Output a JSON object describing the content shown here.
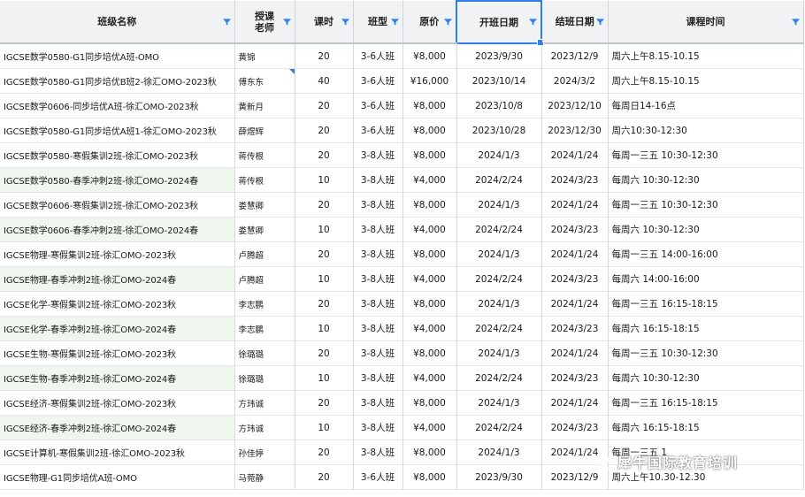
{
  "columns": [
    "班级名称",
    "授课老师",
    "课时",
    "班型",
    "原价",
    "开班日期",
    "结班日期",
    "课程时间"
  ],
  "rows": [
    {
      "name": "IGCSE数学0580-G1同步培优A班-OMO",
      "teacher": "黄锦",
      "hours": "20",
      "type": "3-6人班",
      "price": "¥8,000",
      "start": "2023/9/30",
      "end": "2023/12/9",
      "time": "周六上午8.15-10.15",
      "highlight": false
    },
    {
      "name": "IGCSE数学0580-G1同步培优B班2-徐汇OMO-2023秋",
      "teacher": "傅东东",
      "hours": "40",
      "type": "3-6人班",
      "price": "¥16,000",
      "start": "2023/10/14",
      "end": "2024/3/2",
      "time": "周六上午8.15-10.15",
      "highlight": false
    },
    {
      "name": "IGCSE数学0606-同步培优A班-徐汇OMO-2023秋",
      "teacher": "黄新月",
      "hours": "20",
      "type": "3-6人班",
      "price": "¥8,000",
      "start": "2023/10/8",
      "end": "2023/12/10",
      "time": "每周日14-16点",
      "highlight": false
    },
    {
      "name": "IGCSE数学0580-G1同步培优A班1-徐汇OMO-2023秋",
      "teacher": "薛煜辉",
      "hours": "20",
      "type": "3-6人班",
      "price": "¥8,000",
      "start": "2023/10/28",
      "end": "2023/12/30",
      "time": "周六10:30-12:30",
      "highlight": false
    },
    {
      "name": "IGCSE数学0580-寒假集训2班-徐汇OMO-2023秋",
      "teacher": "蒋传根",
      "hours": "20",
      "type": "3-8人班",
      "price": "¥8,000",
      "start": "2024/1/3",
      "end": "2024/1/24",
      "time": "每周一三五 10:30-12:30",
      "highlight": false
    },
    {
      "name": "IGCSE数学0580-春季冲刺2班-徐汇OMO-2024春",
      "teacher": "蒋传根",
      "hours": "10",
      "type": "3-8人班",
      "price": "¥4,000",
      "start": "2024/2/24",
      "end": "2024/3/23",
      "time": "每周六 10:30-12:30",
      "highlight": true
    },
    {
      "name": "IGCSE数学0606-寒假集训2班-徐汇OMO-2023秋",
      "teacher": "娄慧卿",
      "hours": "20",
      "type": "3-8人班",
      "price": "¥8,000",
      "start": "2024/1/3",
      "end": "2024/1/24",
      "time": "每周一三五 10:30-12:30",
      "highlight": false
    },
    {
      "name": "IGCSE数学0606-春季冲刺2班-徐汇OMO-2024春",
      "teacher": "娄慧卿",
      "hours": "10",
      "type": "3-8人班",
      "price": "¥4,000",
      "start": "2024/2/24",
      "end": "2024/3/23",
      "time": "每周六 10:30-12:30",
      "highlight": true
    },
    {
      "name": "IGCSE物理-寒假集训2班-徐汇OMO-2023秋",
      "teacher": "卢腾超",
      "hours": "20",
      "type": "3-8人班",
      "price": "¥8,000",
      "start": "2024/1/3",
      "end": "2024/1/24",
      "time": "每周一三五 14:00-16:00",
      "highlight": false
    },
    {
      "name": "IGCSE物理-春季冲刺2班-徐汇OMO-2024春",
      "teacher": "卢腾超",
      "hours": "10",
      "type": "3-8人班",
      "price": "¥4,000",
      "start": "2024/2/24",
      "end": "2024/3/23",
      "time": "每周六  14:00-16:00",
      "highlight": true
    },
    {
      "name": "IGCSE化学-寒假集训2班-徐汇OMO-2023秋",
      "teacher": "李志鹏",
      "hours": "20",
      "type": "3-8人班",
      "price": "¥8,000",
      "start": "2024/1/3",
      "end": "2024/1/24",
      "time": "每周一三五 16:15-18:15",
      "highlight": false
    },
    {
      "name": "IGCSE化学-春季冲刺2班-徐汇OMO-2024春",
      "teacher": "李志鹏",
      "hours": "10",
      "type": "3-8人班",
      "price": "¥4,000",
      "start": "2024/2/24",
      "end": "2024/3/23",
      "time": "每周六  16:15-18:15",
      "highlight": true
    },
    {
      "name": "IGCSE生物-寒假集训2班-徐汇OMO-2023秋",
      "teacher": "徐璐璐",
      "hours": "20",
      "type": "3-8人班",
      "price": "¥8,000",
      "start": "2024/1/3",
      "end": "2024/1/24",
      "time": "每周一三五 10:30-12:30",
      "highlight": false
    },
    {
      "name": "IGCSE生物-春季冲刺2班-徐汇OMO-2024春",
      "teacher": "徐璐璐",
      "hours": "10",
      "type": "3-8人班",
      "price": "¥4,000",
      "start": "2024/2/24",
      "end": "2024/3/23",
      "time": "每周六 10:30-12:30",
      "highlight": true
    },
    {
      "name": "IGCSE经济-寒假集训2班-徐汇OMO-2023秋",
      "teacher": "方玮诚",
      "hours": "20",
      "type": "3-8人班",
      "price": "¥8,000",
      "start": "2024/1/3",
      "end": "2024/1/24",
      "time": "每周一三五 16:15-18:15",
      "highlight": false
    },
    {
      "name": "IGCSE经济-春季冲刺2班-徐汇OMO-2024春",
      "teacher": "方玮诚",
      "hours": "10",
      "type": "3-8人班",
      "price": "¥4,000",
      "start": "2024/2/24",
      "end": "2024/3/23",
      "time": "每周六  16:15-18:15",
      "highlight": true
    },
    {
      "name": "IGCSE计算机-寒假集训2班-徐汇OMO-2023秋",
      "teacher": "孙佳婷",
      "hours": "20",
      "type": "3-8人班",
      "price": "¥8,000",
      "start": "2024/1/3",
      "end": "2024/1/24",
      "time": "每周一三五 1",
      "highlight": false
    },
    {
      "name": "IGCSE物理-G1同步培优A班-OMO",
      "teacher": "马菀静",
      "hours": "20",
      "type": "3-6人班",
      "price": "¥8,000",
      "start": "2023/9/30",
      "end": "2023/12/9",
      "time": "周六上午10.30-12.30",
      "highlight": false
    }
  ],
  "watermark": {
    "text": "犀牛国际教育培训",
    "icon": "wechat-icon"
  },
  "colors": {
    "accent": "#2f80ed",
    "highlight_bg": "#eef6ee",
    "header_bg": "#f1f2f4"
  }
}
